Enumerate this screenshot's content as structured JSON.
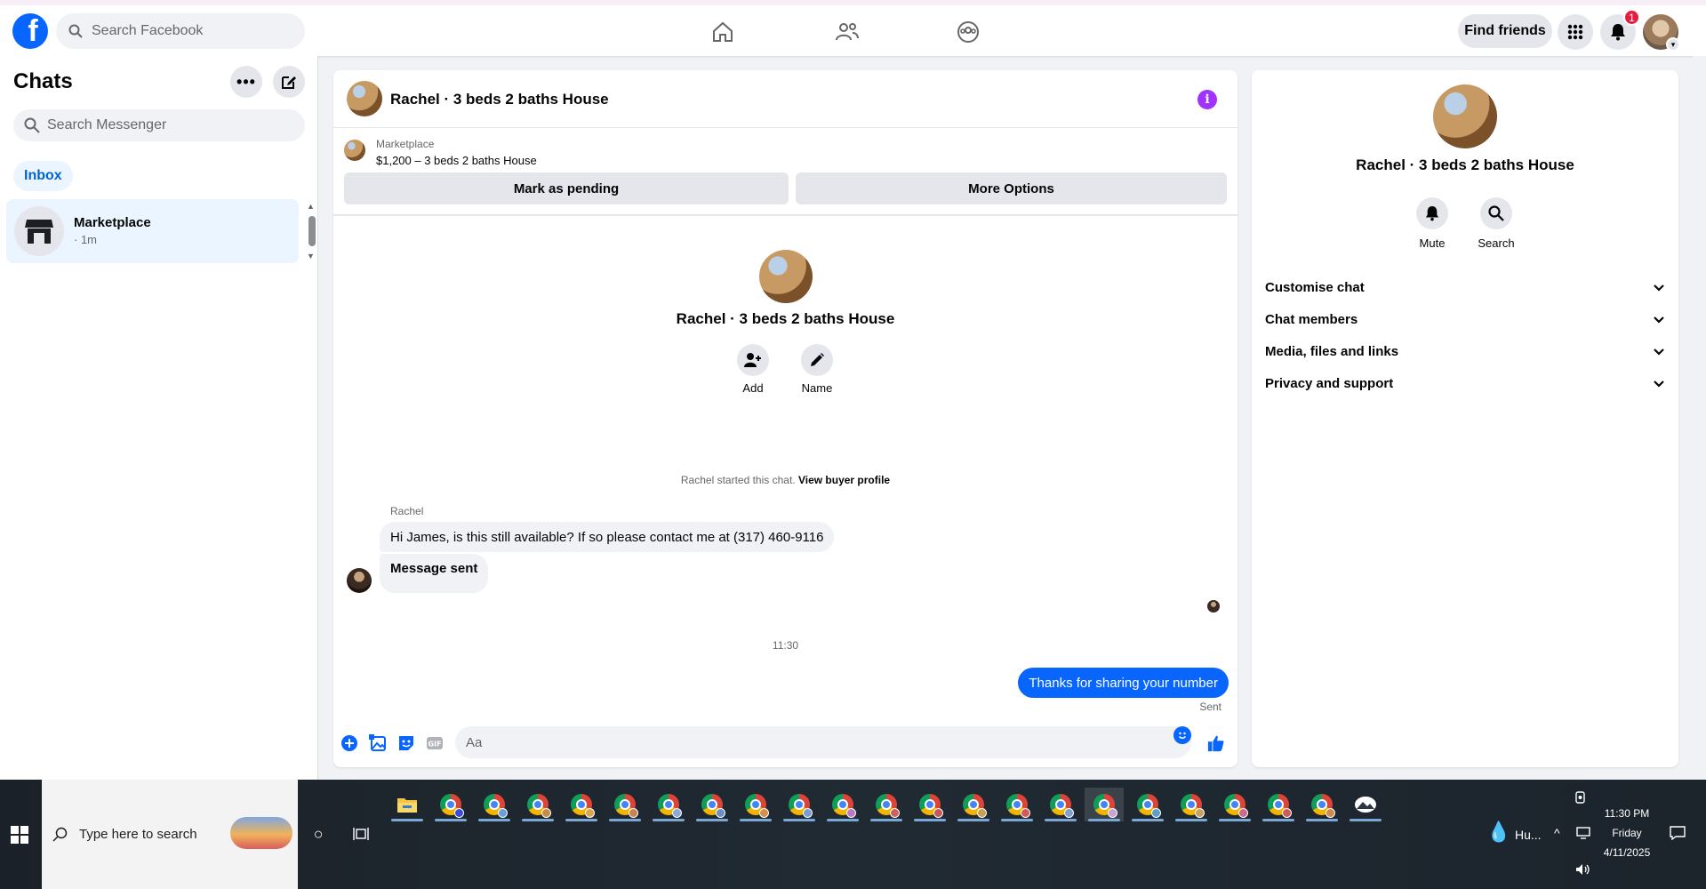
{
  "topbar": {
    "search_placeholder": "Search Facebook",
    "find_friends": "Find friends",
    "notification_count": "1"
  },
  "chats": {
    "title": "Chats",
    "search_placeholder": "Search Messenger",
    "inbox_tab": "Inbox",
    "items": [
      {
        "name": "Marketplace",
        "time": "· 1m"
      }
    ]
  },
  "conversation": {
    "title": "Rachel · 3 beds 2 baths House",
    "listing": {
      "category": "Marketplace",
      "price_title": "$1,200 – 3 beds 2 baths House",
      "mark_pending": "Mark as pending",
      "more_options": "More Options"
    },
    "intro": {
      "title": "Rachel · 3 beds 2 baths House",
      "add_label": "Add",
      "name_label": "Name"
    },
    "started_text": "Rachel started this chat.",
    "view_buyer_profile": "View buyer profile",
    "sender_name": "Rachel",
    "messages_in": [
      "Hi James, is this still available? If so please contact me at (317) 460-9116",
      "Message sent"
    ],
    "timestamp": "11:30",
    "message_out": "Thanks for sharing your number",
    "sent_label": "Sent",
    "composer_placeholder": "Aa"
  },
  "info_panel": {
    "title": "Rachel · 3 beds 2 baths House",
    "mute_label": "Mute",
    "search_label": "Search",
    "sections": [
      "Customise chat",
      "Chat members",
      "Media, files and links",
      "Privacy and support"
    ]
  },
  "taskbar": {
    "search_placeholder": "Type here to search",
    "weather": "Hu...",
    "time": "11:30 PM",
    "day": "Friday",
    "date": "4/11/2025"
  },
  "colors": {
    "facebook_blue": "#0866ff",
    "info_purple": "#a033ff",
    "badge_red": "#e41e3f"
  }
}
